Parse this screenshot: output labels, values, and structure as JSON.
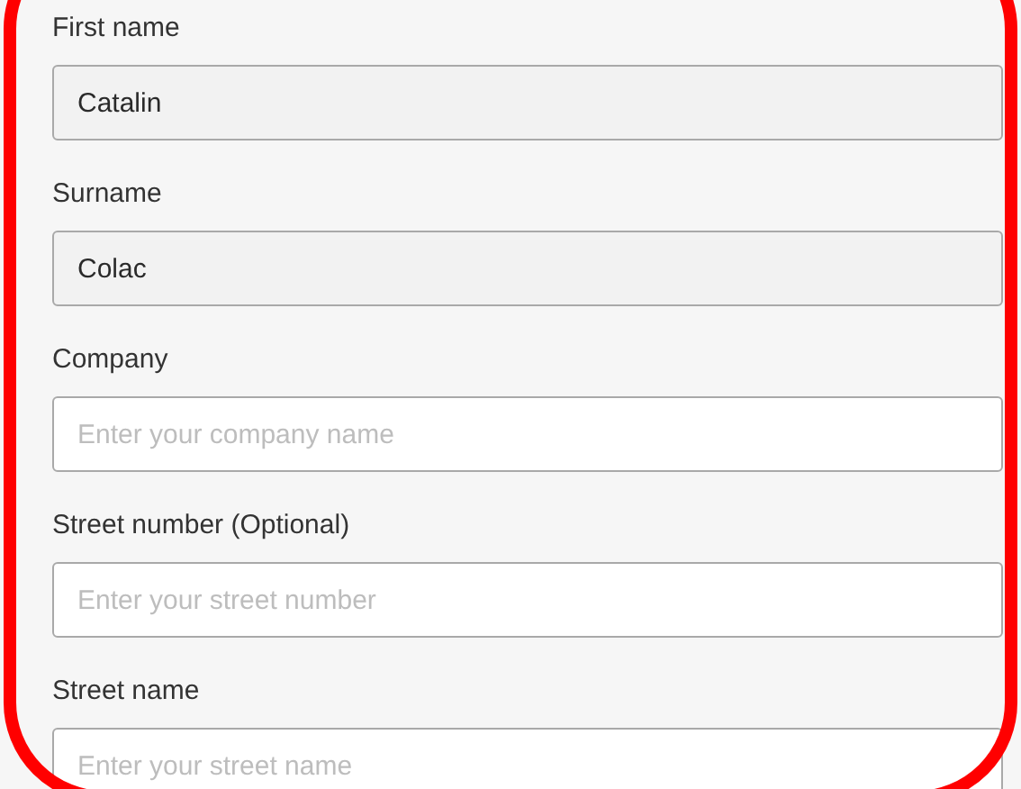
{
  "fields": [
    {
      "label": "First name",
      "value": "Catalin",
      "disabled": true
    },
    {
      "label": "Surname",
      "value": "Colac",
      "disabled": true
    },
    {
      "label": "Company",
      "placeholder": "Enter your company name",
      "disabled": false
    },
    {
      "label": "Street number (Optional)",
      "placeholder": "Enter your street number",
      "disabled": false
    },
    {
      "label": "Street name",
      "placeholder": "Enter your street name",
      "disabled": false
    }
  ]
}
